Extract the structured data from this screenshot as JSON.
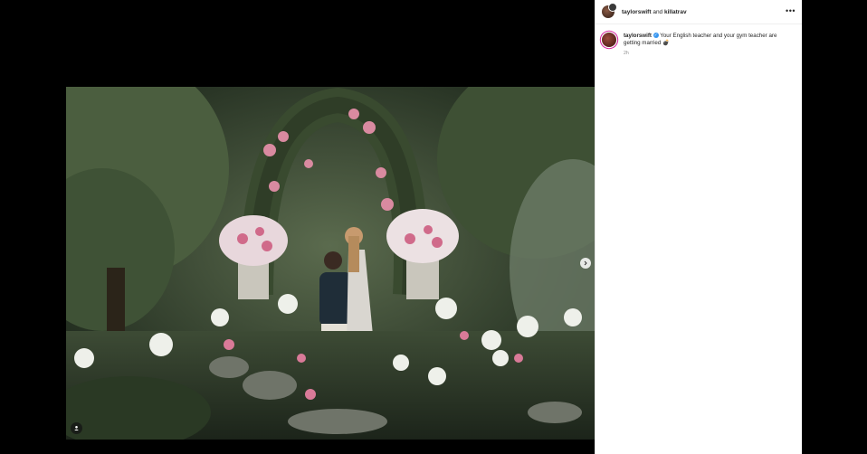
{
  "post": {
    "header": {
      "primary_user": "taylorswift",
      "connector": "and",
      "collab_user": "killatrav",
      "more_icon": "more-horizontal-icon"
    },
    "caption": {
      "username": "taylorswift",
      "verified_icon": "verified-badge-icon",
      "text": "Your English teacher and your gym teacher are getting married",
      "emoji": "💣",
      "time": "2h"
    },
    "media": {
      "description_icon": "photo",
      "next_icon": "chevron-right-icon",
      "tag_icon": "user-tag-icon"
    }
  },
  "colors": {
    "background": "#000000",
    "panel": "#ffffff",
    "text": "#262626",
    "muted": "#8e8e8e",
    "verified": "#3897f0"
  }
}
